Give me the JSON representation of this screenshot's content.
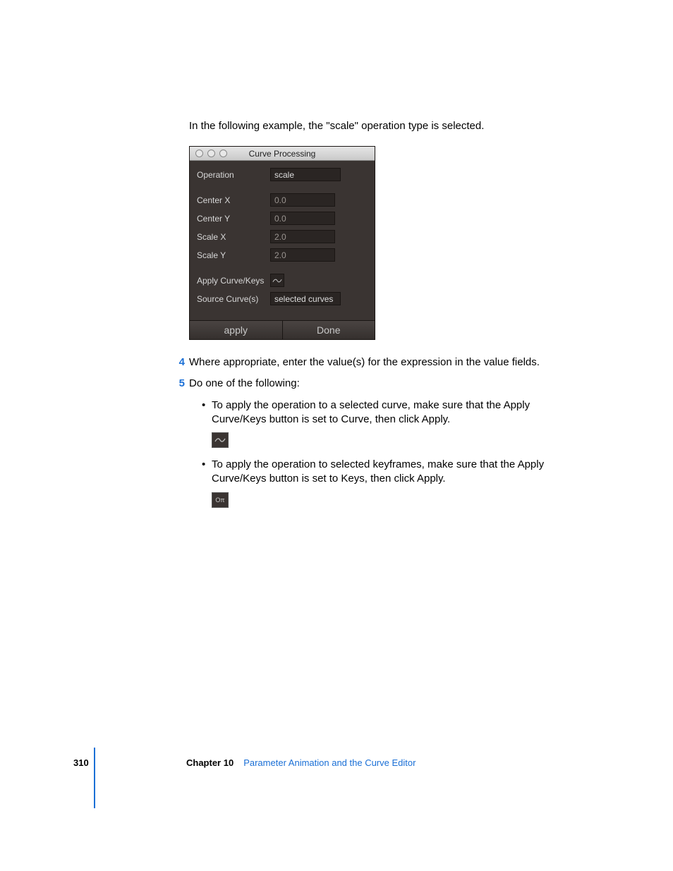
{
  "intro": "In the following example, the \"scale\" operation type is selected.",
  "dialog": {
    "title": "Curve Processing",
    "rows": {
      "operation": {
        "label": "Operation",
        "value": "scale"
      },
      "centerx": {
        "label": "Center X",
        "value": "0.0"
      },
      "centery": {
        "label": "Center Y",
        "value": "0.0"
      },
      "scalex": {
        "label": "Scale X",
        "value": "2.0"
      },
      "scaley": {
        "label": "Scale Y",
        "value": "2.0"
      },
      "applyck": {
        "label": "Apply Curve/Keys"
      },
      "source": {
        "label": "Source Curve(s)",
        "value": "selected curves"
      }
    },
    "buttons": {
      "apply": "apply",
      "done": "Done"
    }
  },
  "steps": {
    "s4": {
      "num": "4",
      "text": "Where appropriate, enter the value(s) for the expression in the value fields."
    },
    "s5": {
      "num": "5",
      "text": "Do one of the following:"
    }
  },
  "bullets": {
    "b1": "To apply the operation to a selected curve, make sure that the Apply Curve/Keys button is set to Curve, then click Apply.",
    "b2": "To apply the operation to selected keyframes, make sure that the Apply Curve/Keys button is set to Keys, then click Apply."
  },
  "keys_chip": "Oπ",
  "footer": {
    "page": "310",
    "chapter_label": "Chapter 10",
    "chapter_title": "Parameter Animation and the Curve Editor"
  }
}
